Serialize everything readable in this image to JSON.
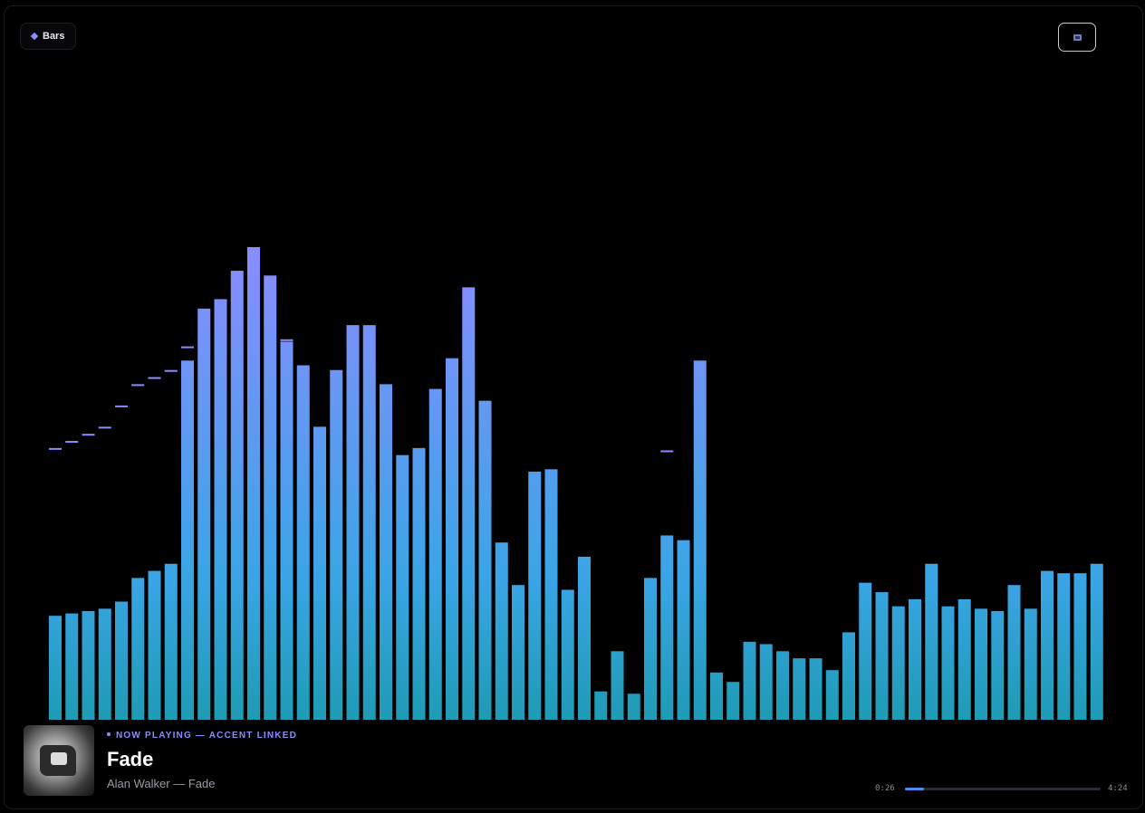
{
  "mode": {
    "label": "Bars",
    "icon": "diamond-icon"
  },
  "corner_button": {
    "icon": "film-icon"
  },
  "now_playing": {
    "label": "NOW PLAYING — ACCENT LINKED",
    "title": "Fade",
    "subtitle": "Alan Walker — Fade",
    "current_time": "0:26",
    "total_time": "4:24",
    "progress": 0.098
  },
  "colors": {
    "accent": "#8a8cff",
    "bar_top": "#8a8cff",
    "bar_mid": "#3aa5e6",
    "bar_bottom": "#1e9bb5"
  },
  "visualizer": {
    "levels": [
      0.22,
      0.225,
      0.23,
      0.235,
      0.25,
      0.3,
      0.315,
      0.33,
      0.76,
      0.87,
      0.89,
      0.95,
      1.0,
      0.94,
      0.8,
      0.75,
      0.62,
      0.74,
      0.835,
      0.835,
      0.71,
      0.56,
      0.575,
      0.7,
      0.765,
      0.915,
      0.675,
      0.375,
      0.285,
      0.525,
      0.53,
      0.275,
      0.345,
      0.06,
      0.145,
      0.055,
      0.3,
      0.39,
      0.38,
      0.76,
      0.1,
      0.08,
      0.165,
      0.16,
      0.145,
      0.13,
      0.13,
      0.105,
      0.185,
      0.29,
      0.27,
      0.24,
      0.255,
      0.33,
      0.24,
      0.255,
      0.235,
      0.23,
      0.285,
      0.235,
      0.315,
      0.31,
      0.31,
      0.33
    ],
    "peaks": [
      0.575,
      0.59,
      0.605,
      0.62,
      0.665,
      0.71,
      0.725,
      0.74,
      0.79,
      0,
      0,
      0,
      0,
      0,
      0.805,
      0,
      0,
      0,
      0,
      0,
      0,
      0,
      0,
      0,
      0,
      0,
      0,
      0,
      0,
      0,
      0,
      0,
      0,
      0,
      0,
      0,
      0,
      0.57,
      0,
      0,
      0,
      0,
      0,
      0,
      0,
      0,
      0,
      0,
      0,
      0,
      0,
      0,
      0,
      0,
      0,
      0,
      0,
      0,
      0,
      0,
      0,
      0,
      0,
      0
    ]
  }
}
